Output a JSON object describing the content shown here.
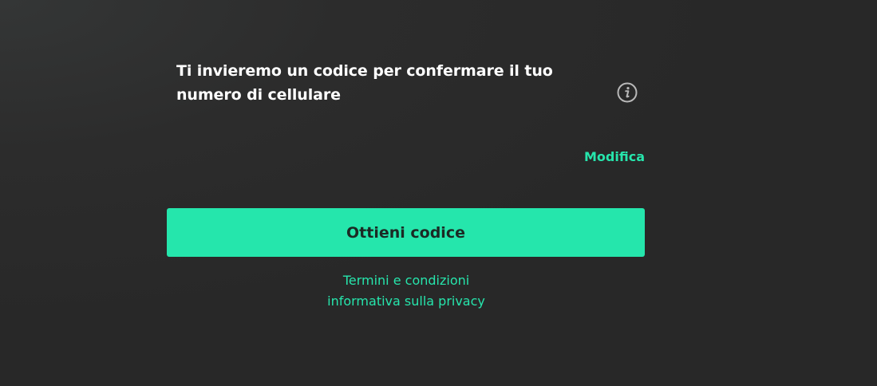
{
  "verification": {
    "heading": "Ti invieremo un codice per confermare il tuo numero di cellulare",
    "info_icon": "info-circle-icon",
    "edit_label": "Modifica",
    "submit_label": "Ottieni codice"
  },
  "footer": {
    "links": [
      {
        "label": "Termini e condizioni"
      },
      {
        "label": "informativa sulla privacy"
      }
    ]
  },
  "colors": {
    "accent": "#25e6ac",
    "background": "#282828",
    "text": "#ffffff",
    "button_text": "#1b2a24",
    "icon": "#b8b8b8"
  }
}
